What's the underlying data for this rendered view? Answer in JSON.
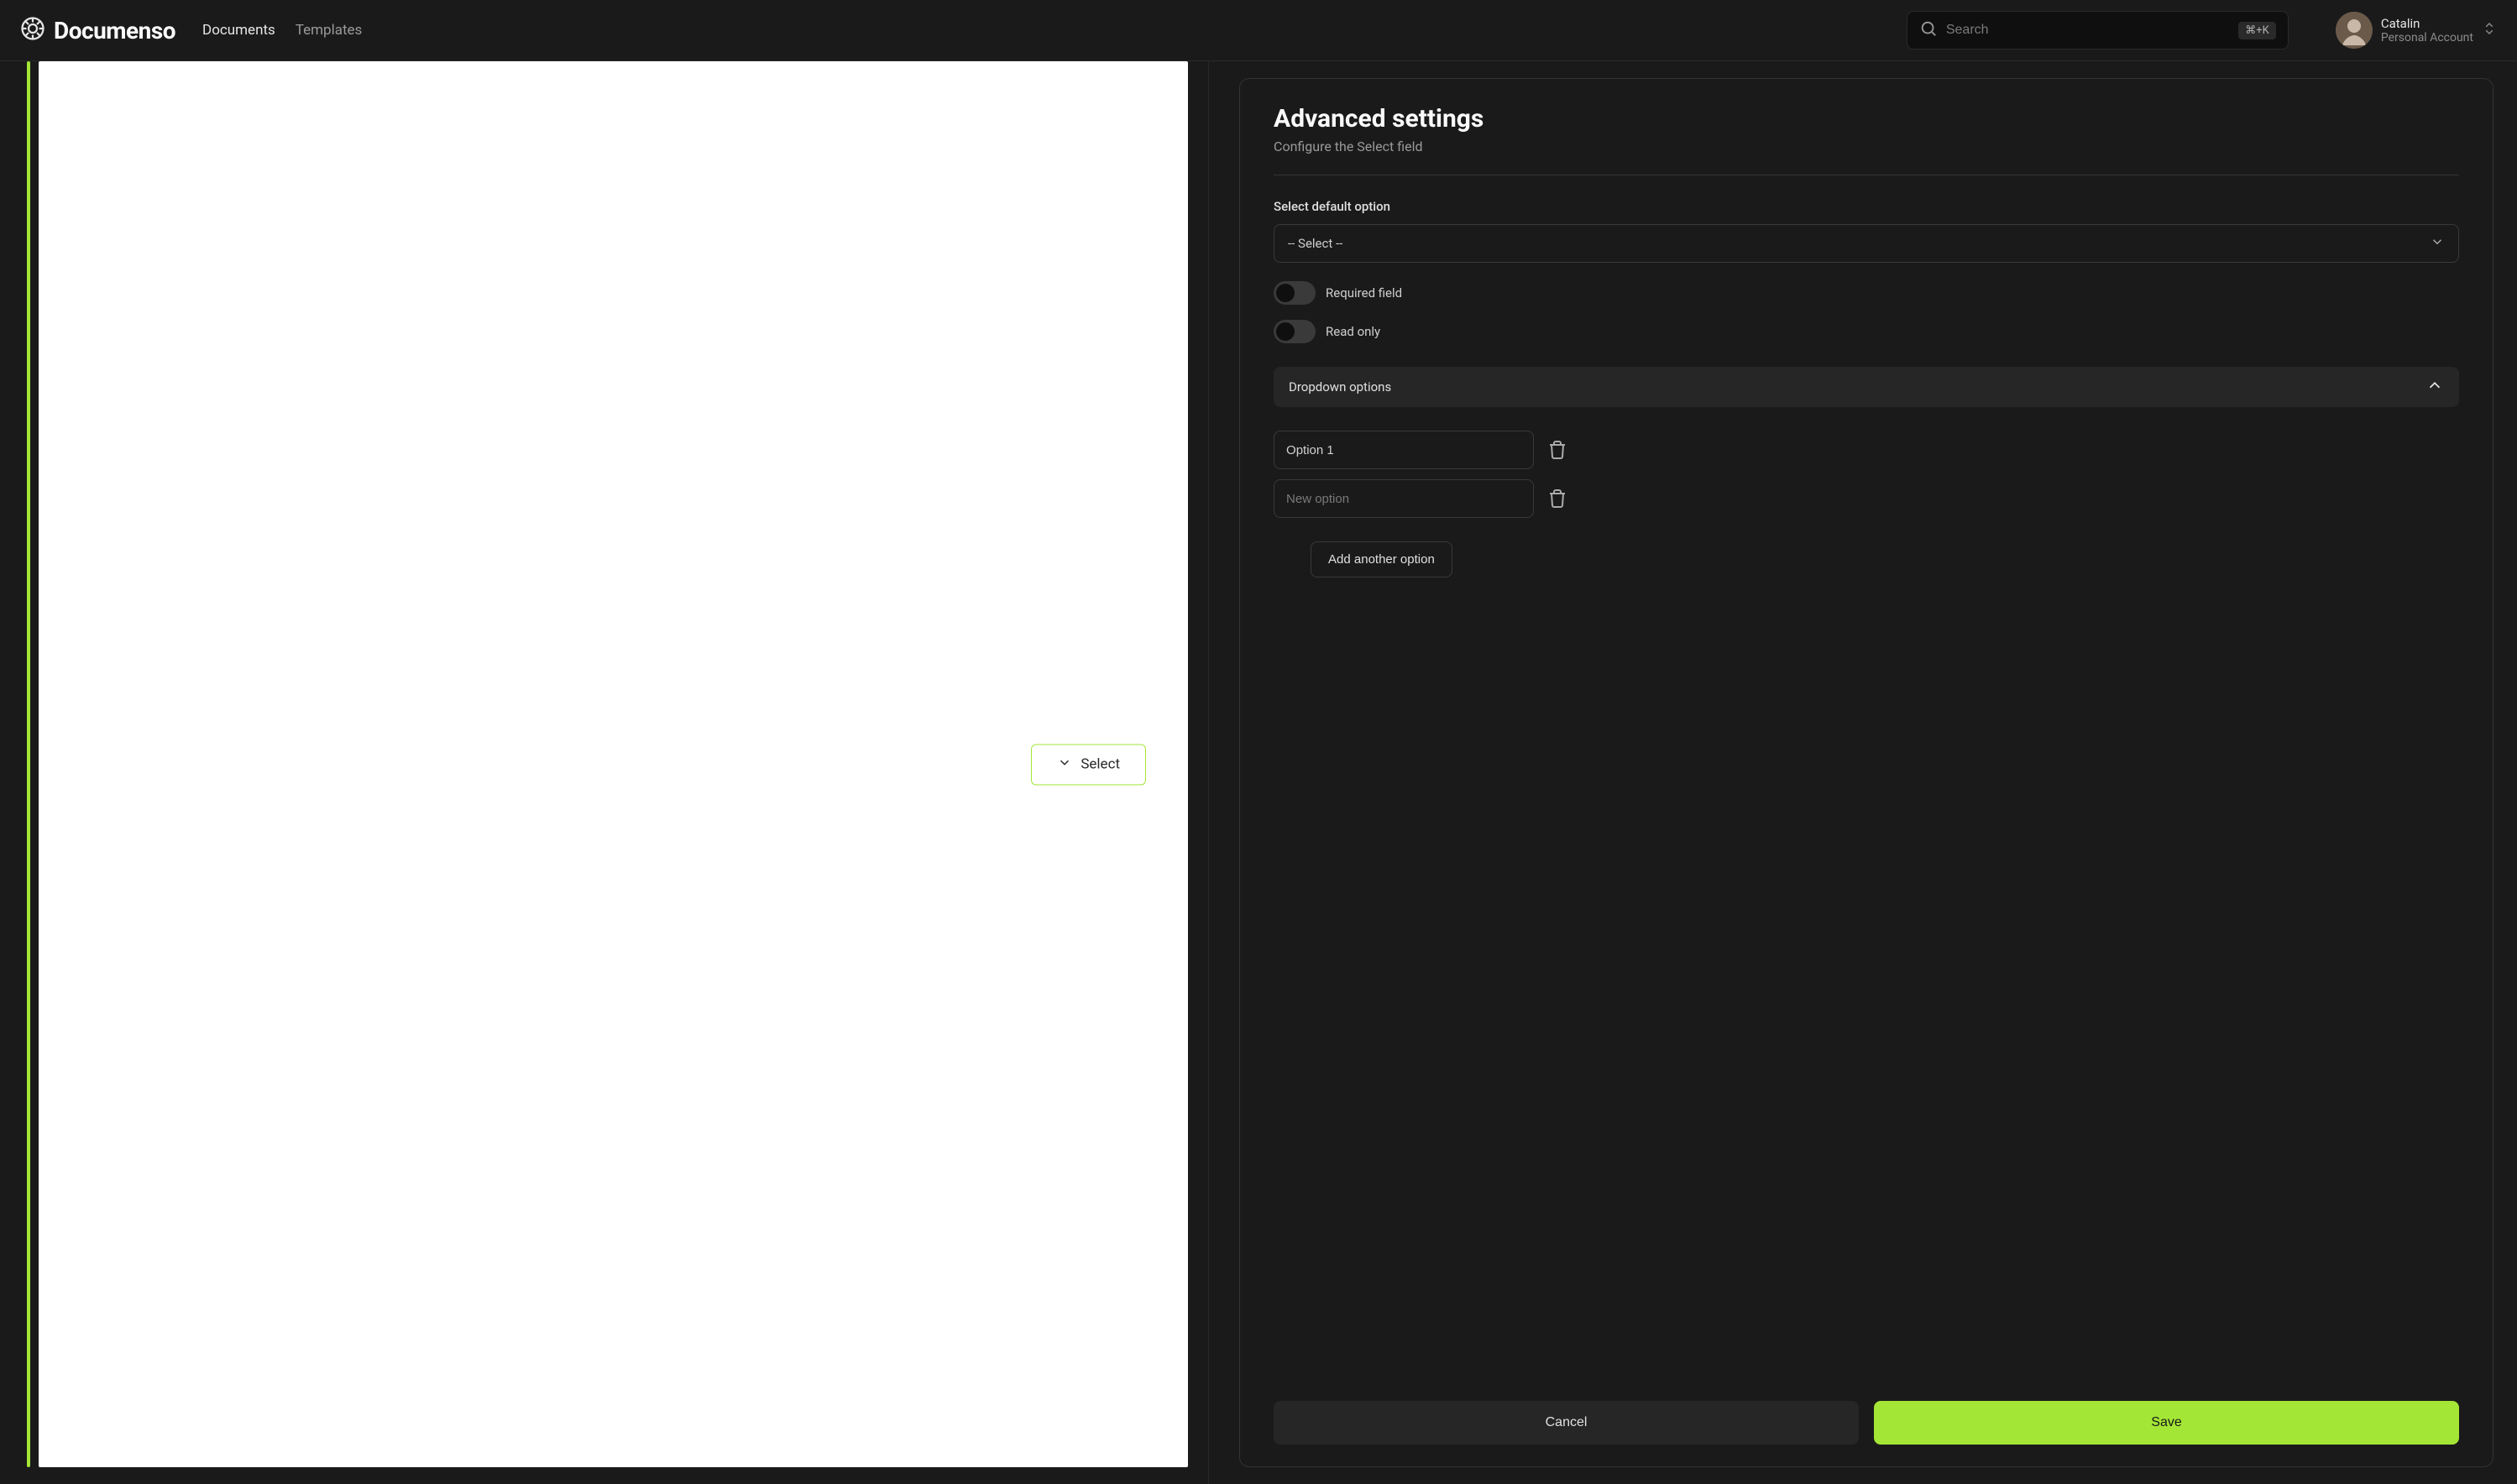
{
  "header": {
    "brand": "Documenso",
    "nav": {
      "documents": "Documents",
      "templates": "Templates"
    },
    "search": {
      "placeholder": "Search",
      "shortcut": "⌘+K"
    },
    "account": {
      "name": "Catalin",
      "sub": "Personal Account"
    }
  },
  "docField": {
    "label": "Select"
  },
  "panel": {
    "title": "Advanced settings",
    "subtitle": "Configure the Select field",
    "defaultOption": {
      "label": "Select default option",
      "value": "-- Select --"
    },
    "toggles": {
      "required": "Required field",
      "readonly": "Read only"
    },
    "dropdown": {
      "header": "Dropdown options",
      "options": [
        {
          "value": "Option 1"
        },
        {
          "value": "",
          "placeholder": "New option"
        }
      ],
      "addLabel": "Add another option"
    },
    "buttons": {
      "cancel": "Cancel",
      "save": "Save"
    }
  }
}
